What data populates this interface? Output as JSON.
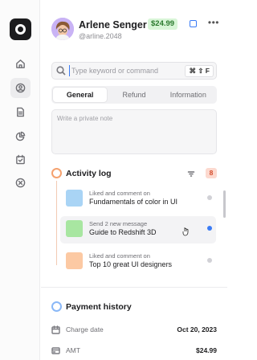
{
  "window": {
    "controls": [
      "close",
      "minimize",
      "zoom"
    ]
  },
  "sidebar": {
    "logo_icon": "app-logo-icon",
    "items": [
      {
        "icon": "home-icon",
        "active": false
      },
      {
        "icon": "user-icon",
        "active": true
      },
      {
        "icon": "document-icon",
        "active": false
      },
      {
        "icon": "pie-chart-icon",
        "active": false
      },
      {
        "icon": "calendar-check-icon",
        "active": false
      },
      {
        "icon": "settings-icon",
        "active": false
      }
    ]
  },
  "header": {
    "name": "Arlene Senger",
    "handle": "@arline.2048",
    "price_badge": "$24.99",
    "more_label": "•••"
  },
  "search": {
    "placeholder": "Type keyword or command",
    "value": "",
    "shortcut": "⌘ ⇧ F"
  },
  "tabs": [
    {
      "label": "General",
      "active": true
    },
    {
      "label": "Refund",
      "active": false
    },
    {
      "label": "Information",
      "active": false
    }
  ],
  "note": {
    "placeholder": "Write a private note",
    "value": ""
  },
  "activity": {
    "title": "Activity log",
    "count": "8",
    "items": [
      {
        "label": "Liked and comment on",
        "title": "Fundamentals of color in UI",
        "thumb_color": "#a9d4f5",
        "unread": false
      },
      {
        "label": "Send 2 new message",
        "title": "Guide to Redshift 3D",
        "thumb_color": "#a8e6a1",
        "unread": true
      },
      {
        "label": "Liked and comment on",
        "title": "Top 10 great UI designers",
        "thumb_color": "#fcc9a3",
        "unread": false
      }
    ]
  },
  "payment": {
    "title": "Payment history",
    "rows": [
      {
        "icon": "calendar-icon",
        "label": "Charge date",
        "value": "Oct 20, 2023"
      },
      {
        "icon": "card-icon",
        "label": "AMT",
        "value": "$24.99"
      }
    ]
  },
  "colors": {
    "accent_blue": "#3a7bf5",
    "price_green_bg": "#d8f5d7",
    "price_green_text": "#2b7a2e",
    "activity_orange": "#f5a26f",
    "count_bg": "#fcd9cf"
  }
}
